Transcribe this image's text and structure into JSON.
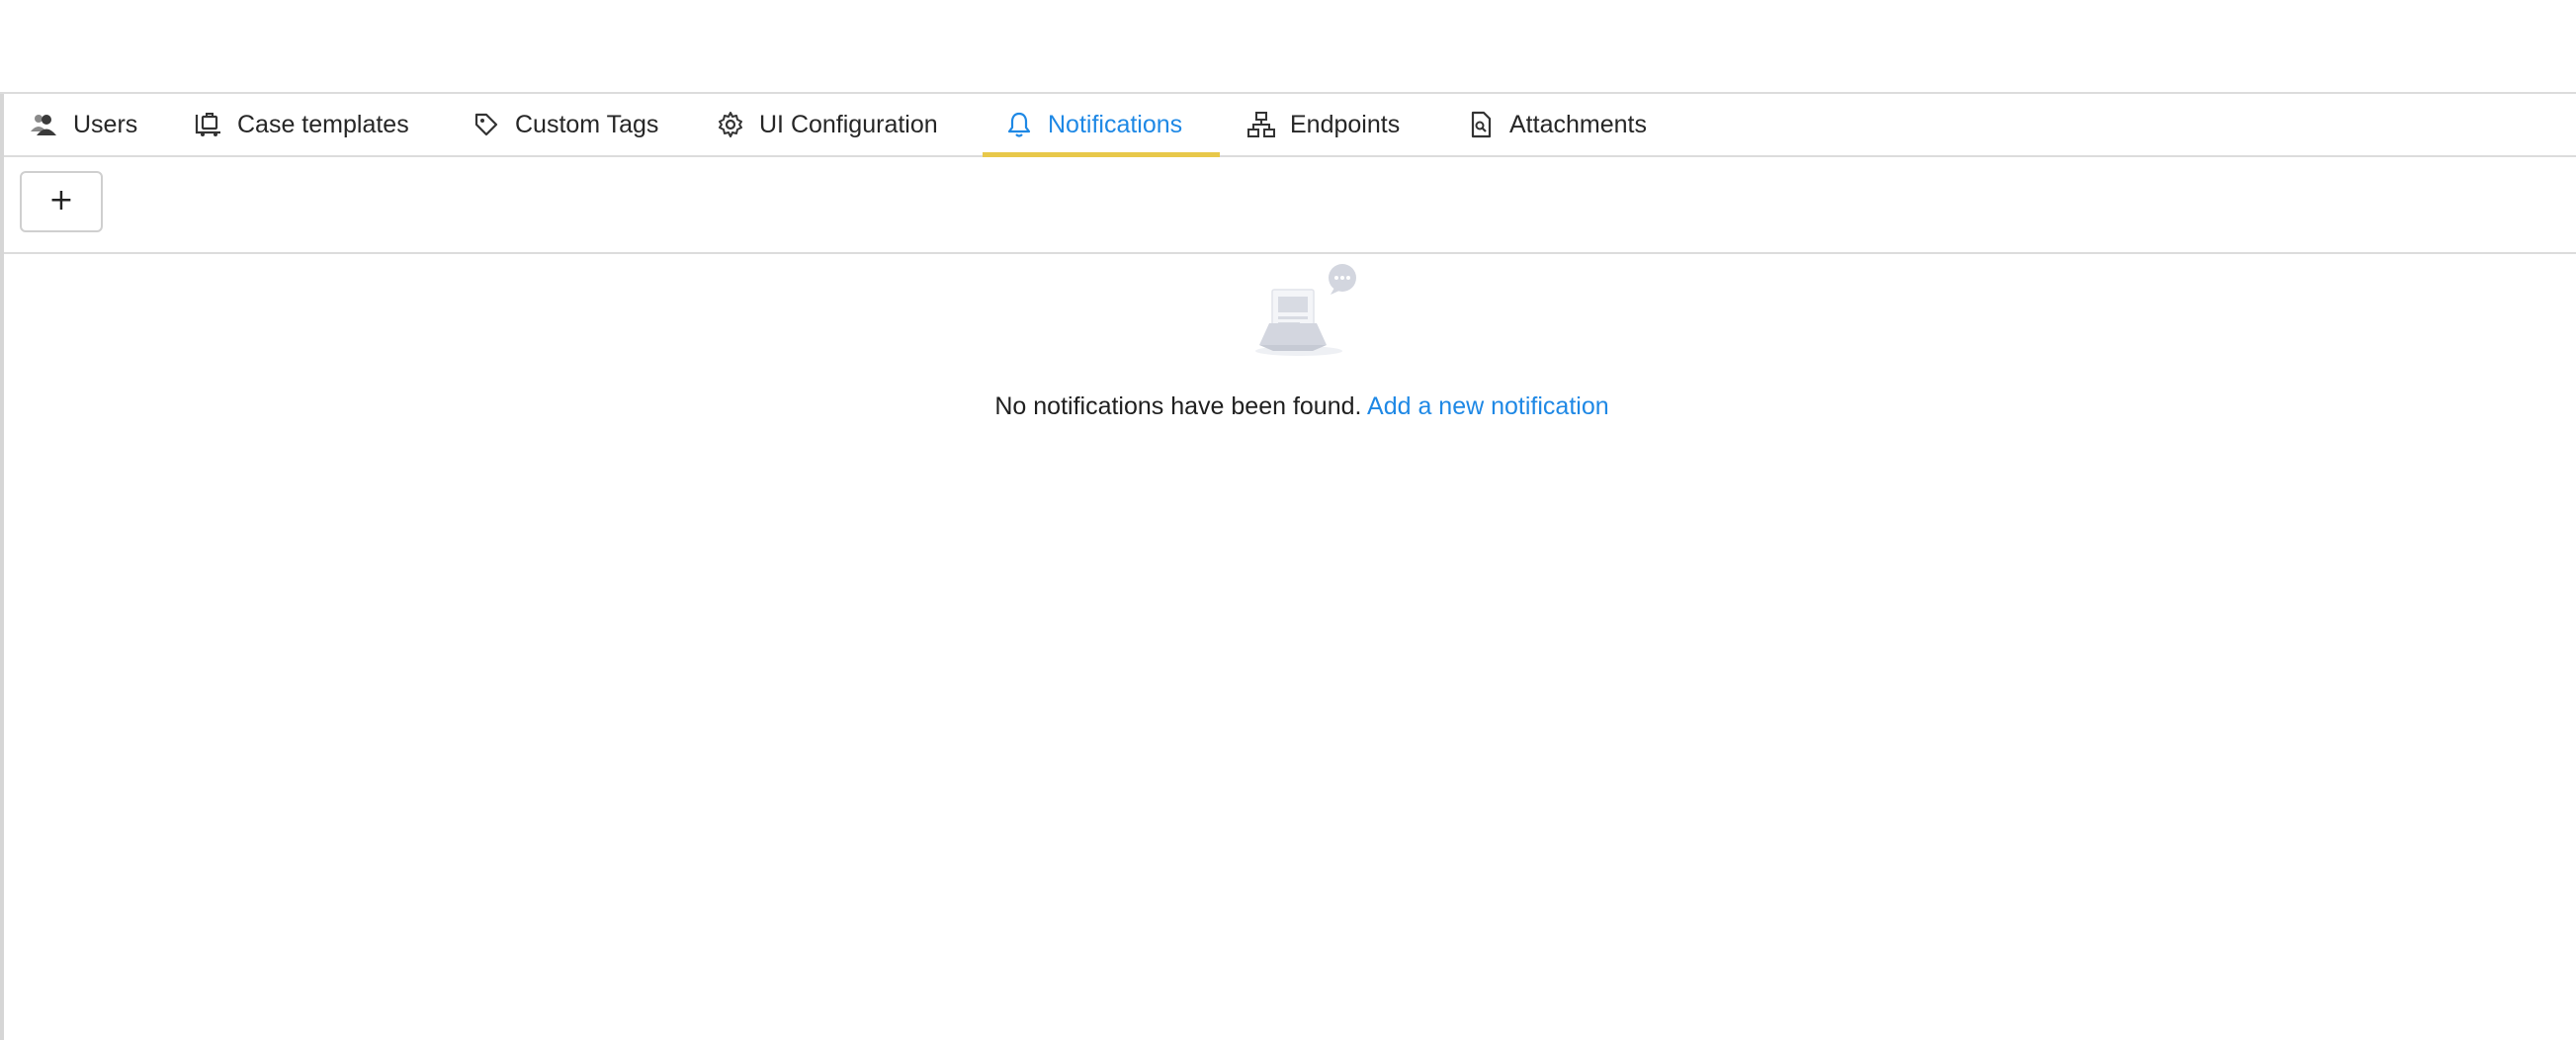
{
  "tabs": [
    {
      "label": "Users",
      "icon": "users-icon"
    },
    {
      "label": "Case templates",
      "icon": "case-templates-icon"
    },
    {
      "label": "Custom Tags",
      "icon": "tag-icon"
    },
    {
      "label": "UI Configuration",
      "icon": "gear-icon"
    },
    {
      "label": "Notifications",
      "icon": "bell-icon",
      "active": true
    },
    {
      "label": "Endpoints",
      "icon": "network-icon"
    },
    {
      "label": "Attachments",
      "icon": "file-search-icon"
    }
  ],
  "toolbar": {
    "add_label": "+"
  },
  "empty_state": {
    "message": "No notifications have been found.",
    "link_label": "Add a new notification"
  },
  "colors": {
    "accent": "#1e88e5",
    "active_underline": "#e8c84a",
    "border": "#dcdcdc"
  }
}
